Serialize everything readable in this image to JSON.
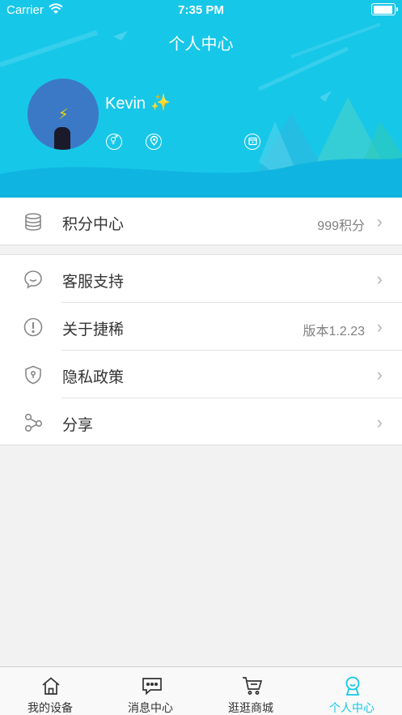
{
  "status_bar": {
    "carrier": "Carrier",
    "time": "7:35 PM"
  },
  "header": {
    "title": "个人中心",
    "username": "Kevin",
    "username_emoji": "✨"
  },
  "menu_group_1": [
    {
      "icon": "coins-stack-icon",
      "label": "积分中心",
      "value": "999积分"
    }
  ],
  "menu_group_2": [
    {
      "icon": "chat-bubble-icon",
      "label": "客服支持",
      "value": ""
    },
    {
      "icon": "info-exclamation-icon",
      "label": "关于捷稀",
      "value": "版本1.2.23"
    },
    {
      "icon": "shield-lock-icon",
      "label": "隐私政策",
      "value": ""
    },
    {
      "icon": "share-icon",
      "label": "分享",
      "value": ""
    }
  ],
  "tabbar": [
    {
      "icon": "home-icon",
      "label": "我的设备",
      "active": false
    },
    {
      "icon": "message-icon",
      "label": "消息中心",
      "active": false
    },
    {
      "icon": "cart-icon",
      "label": "逛逛商城",
      "active": false
    },
    {
      "icon": "profile-icon",
      "label": "个人中心",
      "active": true
    }
  ],
  "colors": {
    "accent": "#17c7e8",
    "header_bg": "#17c7e8"
  }
}
